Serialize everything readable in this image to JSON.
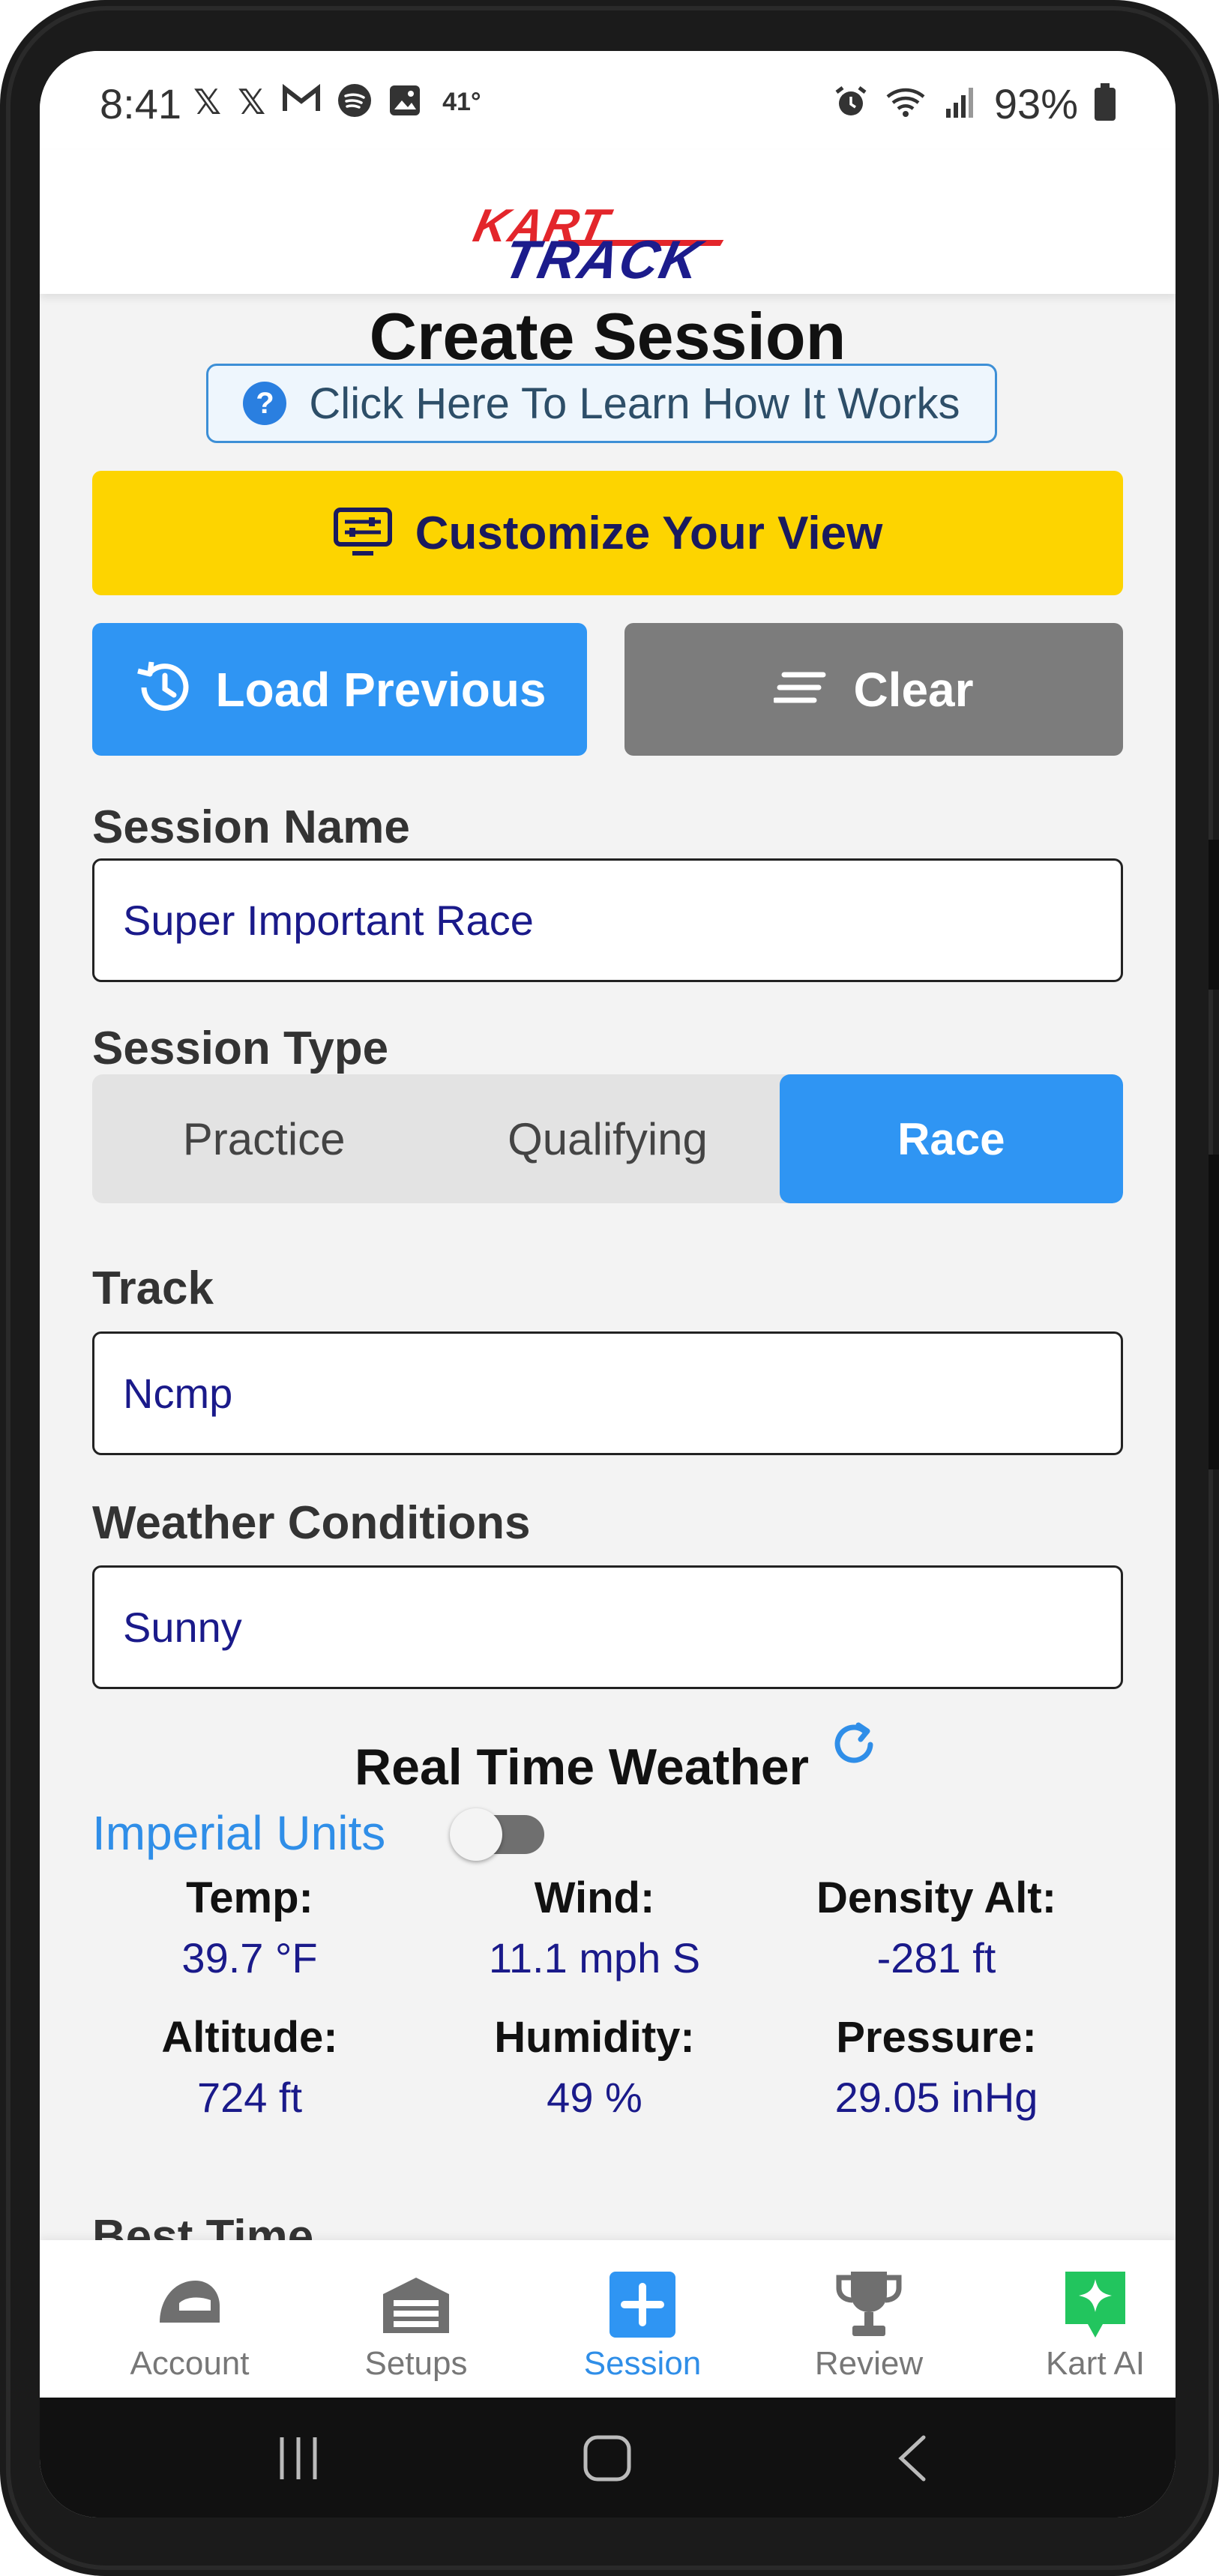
{
  "status_bar": {
    "time": "8:41",
    "left_icons": [
      "x-icon",
      "x-icon",
      "gmail-icon",
      "spotify-icon",
      "gallery-icon"
    ],
    "temperature": "41°",
    "right_icons": [
      "alarm-icon",
      "wifi-icon",
      "signal-icon"
    ],
    "battery": "93%"
  },
  "header": {
    "logo_line1": "KART",
    "logo_line2": "TRACK"
  },
  "page": {
    "title": "Create Session",
    "learn_label": "Click Here To Learn How It Works",
    "customize_label": "Customize Your View",
    "load_previous_label": "Load Previous",
    "clear_label": "Clear"
  },
  "form": {
    "session_name_label": "Session Name",
    "session_name_value": "Super Important Race",
    "session_type_label": "Session Type",
    "session_types": [
      "Practice",
      "Qualifying",
      "Race"
    ],
    "session_type_selected": "Race",
    "track_label": "Track",
    "track_value": "Ncmp",
    "weather_label": "Weather Conditions",
    "weather_value": "Sunny"
  },
  "weather": {
    "title": "Real Time Weather",
    "units_label": "Imperial Units",
    "units_toggle_on": false,
    "temp_label": "Temp:",
    "temp_value": "39.7 °F",
    "wind_label": "Wind:",
    "wind_value": "11.1 mph S",
    "density_label": "Density Alt:",
    "density_value": "-281 ft",
    "altitude_label": "Altitude:",
    "altitude_value": "724 ft",
    "humidity_label": "Humidity:",
    "humidity_value": "49 %",
    "pressure_label": "Pressure:",
    "pressure_value": "29.05 inHg"
  },
  "partial_section_label": "Best Time",
  "bottom_nav": {
    "items": [
      {
        "label": "Account",
        "icon": "helmet-icon"
      },
      {
        "label": "Setups",
        "icon": "garage-icon"
      },
      {
        "label": "Session",
        "icon": "plus-square-icon"
      },
      {
        "label": "Review",
        "icon": "trophy-icon"
      },
      {
        "label": "Kart AI",
        "icon": "ai-sparkle-icon"
      }
    ],
    "active": "Session"
  },
  "colors": {
    "primary_blue": "#2f95f3",
    "accent_yellow": "#fdd400",
    "clear_gray": "#7c7c7c",
    "value_navy": "#1a1a8a",
    "ai_green": "#22c55e"
  }
}
